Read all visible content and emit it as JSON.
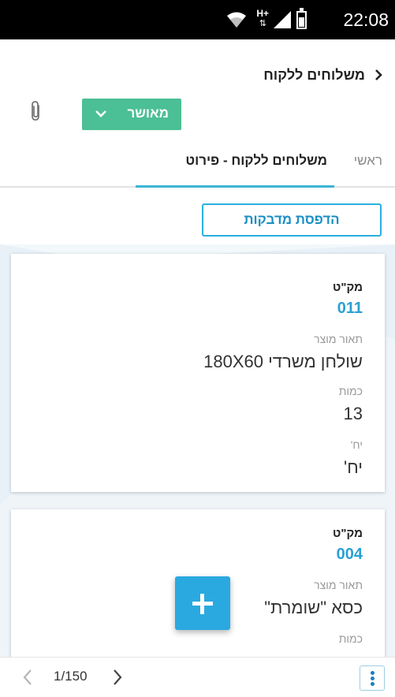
{
  "status_bar": {
    "time": "22:08",
    "network": "H+",
    "icons": [
      "wifi-icon",
      "data-arrows-icon",
      "signal-icon",
      "battery-icon"
    ]
  },
  "header": {
    "title": "משלוחים ללקוח",
    "back_icon": "chevron-right-icon"
  },
  "status_select": {
    "value": "מאושר",
    "icon": "chevron-down-icon",
    "color": "#4bbf95"
  },
  "attachment_icon": "paperclip-icon",
  "tabs": [
    {
      "label": "ראשי",
      "active": false
    },
    {
      "label": "משלוחים ללקוח - פירוט",
      "active": true
    }
  ],
  "print_button": {
    "label": "הדפסת מדבקות"
  },
  "cards": [
    {
      "sku_label": "מק\"ט",
      "sku": "011",
      "desc_label": "תאור מוצר",
      "desc": "שולחן משרדי 180X60",
      "qty_label": "כמות",
      "qty": "13",
      "unit_label": "יח'",
      "unit": "יח'"
    },
    {
      "sku_label": "מק\"ט",
      "sku": "004",
      "desc_label": "תאור מוצר",
      "desc": "כסא \"שומרת\"",
      "qty_label": "כמות"
    }
  ],
  "fab": {
    "icon": "plus-icon"
  },
  "pager": {
    "text": "1/150",
    "prev_icon": "chevron-left-icon",
    "next_icon": "chevron-right-icon",
    "more_icon": "more-vertical-icon"
  },
  "colors": {
    "accent": "#2aa9e0",
    "approved": "#4bbf95",
    "tab_indicator": "#3bb4d6"
  }
}
